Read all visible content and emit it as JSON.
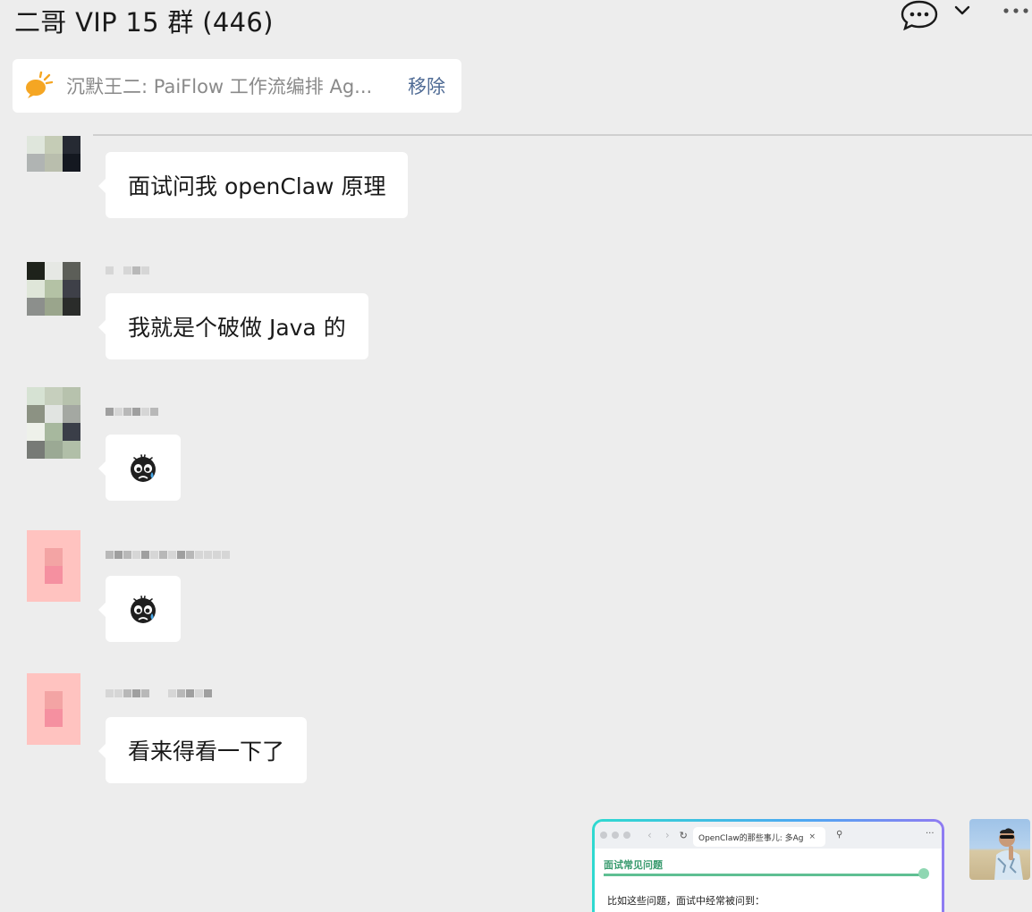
{
  "header": {
    "title": "二哥 VIP 15 群 (446)",
    "icons": [
      "chat-bubble-icon",
      "chevron-down-icon",
      "more-horizontal-icon"
    ]
  },
  "pinned": {
    "icon": "megaphone-icon",
    "text": "沉默王二: PaiFlow 工作流编排 Ag...",
    "remove_label": "移除",
    "accent_color": "#f5a623"
  },
  "messages": [
    {
      "type": "text",
      "text": "面试问我 openClaw 原理"
    },
    {
      "type": "text",
      "text": "我就是个破做 Java 的"
    },
    {
      "type": "emoji",
      "emoji": "crying-sticker-icon"
    },
    {
      "type": "emoji",
      "emoji": "crying-sticker-icon"
    },
    {
      "type": "text",
      "text": "看来得看一下了"
    }
  ],
  "self_message": {
    "type": "image",
    "browser_tab_title": "OpenClaw的那些事儿: 多Ag",
    "page_heading": "面试常见问题",
    "page_text": "比如这些问题，面试中经常被问到："
  },
  "colors": {
    "background": "#ededed",
    "bubble": "#ffffff",
    "link": "#4e6a94"
  }
}
